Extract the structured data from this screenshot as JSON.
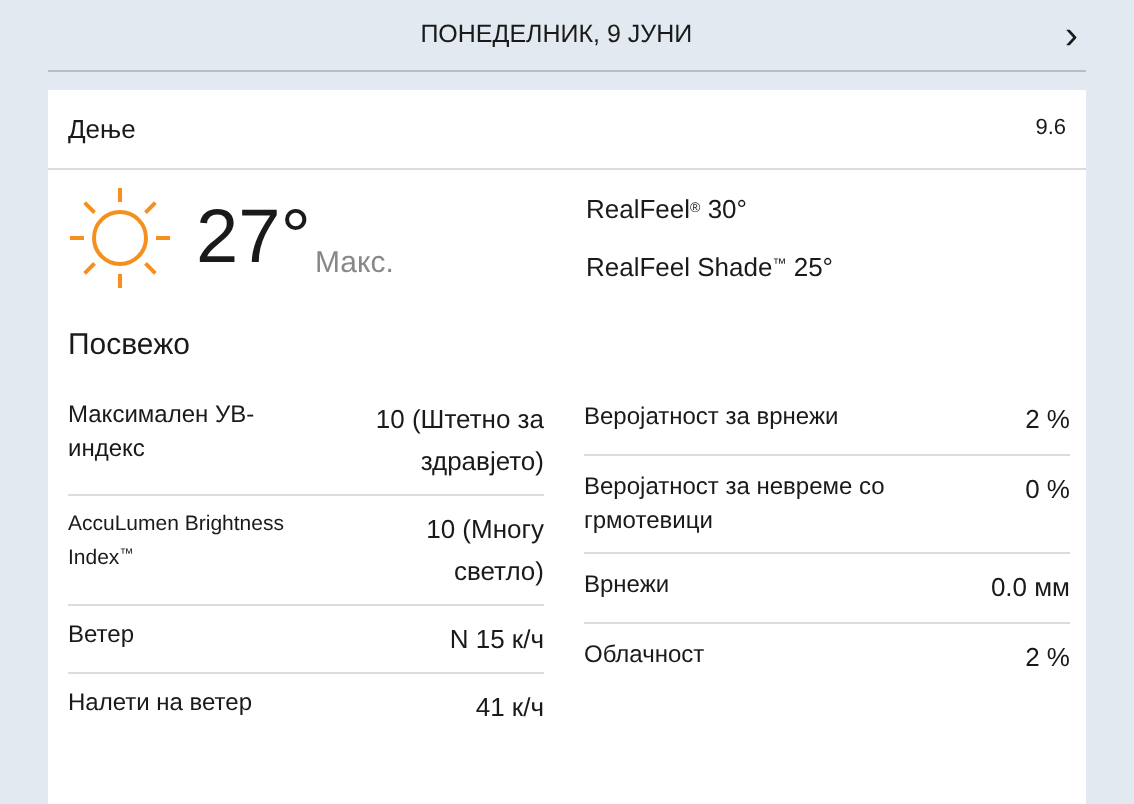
{
  "day_header": {
    "title": "ПОНЕДЕЛНИК, 9 ЈУНИ",
    "next": "›"
  },
  "card": {
    "period": "Дење",
    "date": "9.6",
    "temperature": "27°",
    "temperature_label": "Макс.",
    "realfeel": [
      "RealFeel$^{®}$ 30°",
      "RealFeel Shade$^{™}$ 25°"
    ],
    "phrase": "Посвежо",
    "left_details": [
      {
        "label": "Максимален УВ-индекс",
        "value": "10 (Штетно за здравјето)",
        "small": false
      },
      {
        "label": "AccuLumen Brightness Index$^{™}$",
        "value": "10 (Многу светло)",
        "small": true
      },
      {
        "label": "Ветер",
        "value": "N 15 к/ч",
        "small": false
      },
      {
        "label": "Налети на ветер",
        "value": "41 к/ч",
        "small": false
      }
    ],
    "right_details": [
      {
        "label": "Веројатност за врнежи",
        "value": "2 %"
      },
      {
        "label": "Веројатност за невреме со грмотевици",
        "value": "0 %"
      },
      {
        "label": "Врнежи",
        "value": "0.0 мм"
      },
      {
        "label": "Облачност",
        "value": "2 %"
      }
    ]
  }
}
